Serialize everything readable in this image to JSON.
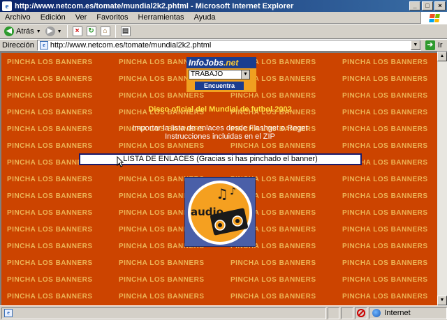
{
  "window": {
    "title": "http://www.netcom.es/tomate/mundial2k2.phtml - Microsoft Internet Explorer",
    "buttons": {
      "minimize": "_",
      "maximize": "□",
      "close": "×"
    }
  },
  "menu": [
    "Archivo",
    "Edición",
    "Ver",
    "Favoritos",
    "Herramientas",
    "Ayuda"
  ],
  "toolbar": {
    "back_label": "Atrás"
  },
  "address": {
    "label": "Dirección",
    "url": "http://www.netcom.es/tomate/mundial2k2.phtml",
    "go_label": "Ir"
  },
  "page": {
    "banner_text": "PINCHA LOS BANNERS",
    "infojobs": {
      "logo_main": "InfoJobs",
      "logo_suffix": ".net",
      "select_value": "TRABAJO",
      "button_label": "Encuentra"
    },
    "headline": "Disco oficial del Mundial de futbol 2002",
    "instructions_line1": "Importar la lista de enlaces desde Flashget o Reget",
    "instructions_line2": "Instrucciones incluidas en el ZIP",
    "links_button": "LISTA DE ENLACES (Gracias si has pinchado el banner)",
    "audio_image_text": "audio"
  },
  "status": {
    "zone_label": "Internet"
  },
  "colors": {
    "page_background": "#cc4400",
    "banner_text": "#f0c060",
    "headline": "#ffe040",
    "title_bar": "#0a246a"
  }
}
